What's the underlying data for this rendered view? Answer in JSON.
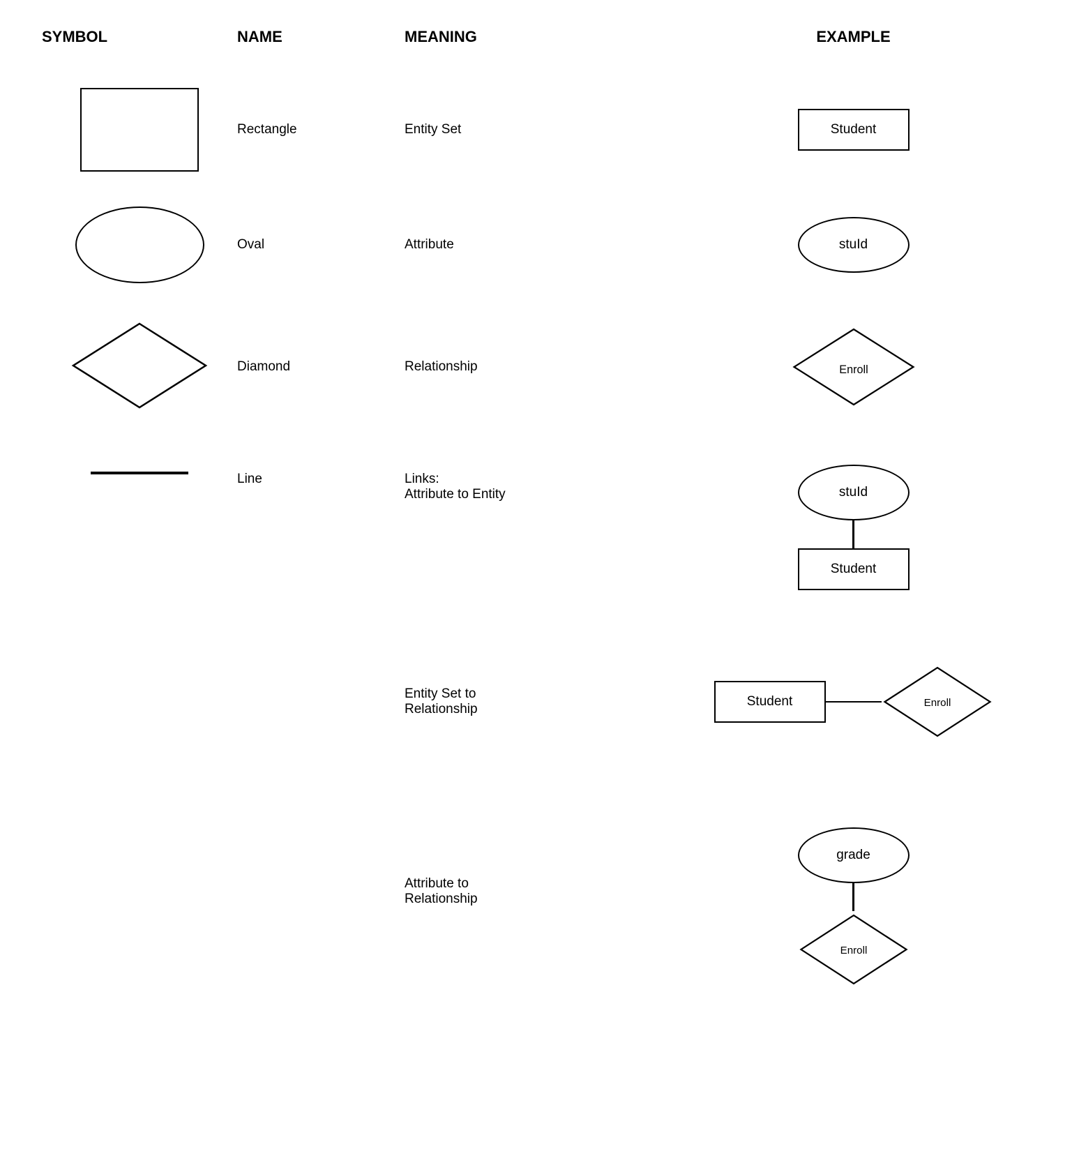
{
  "header": {
    "symbol": "SYMBOL",
    "name": "NAME",
    "meaning": "MEANING",
    "example": "EXAMPLE"
  },
  "rows": [
    {
      "id": "rectangle",
      "name": "Rectangle",
      "meaning": "Entity Set",
      "example_label": "Student",
      "example_type": "rect"
    },
    {
      "id": "oval",
      "name": "Oval",
      "meaning": "Attribute",
      "example_label": "stuId",
      "example_type": "oval"
    },
    {
      "id": "diamond",
      "name": "Diamond",
      "meaning": "Relationship",
      "example_label": "Enroll",
      "example_type": "diamond"
    },
    {
      "id": "line",
      "name": "Line",
      "meaning_line1": "Links:",
      "meaning_line2": "Attribute to Entity",
      "example_oval": "stuId",
      "example_rect": "Student",
      "example_type": "line"
    }
  ],
  "extra_rows": [
    {
      "id": "entity-set-to-relationship",
      "meaning_line1": "Entity Set to",
      "meaning_line2": "Relationship",
      "rect_label": "Student",
      "diamond_label": "Enroll"
    },
    {
      "id": "attribute-to-relationship",
      "meaning_line1": "Attribute to",
      "meaning_line2": "Relationship",
      "oval_label": "grade",
      "diamond_label": "Enroll"
    }
  ]
}
